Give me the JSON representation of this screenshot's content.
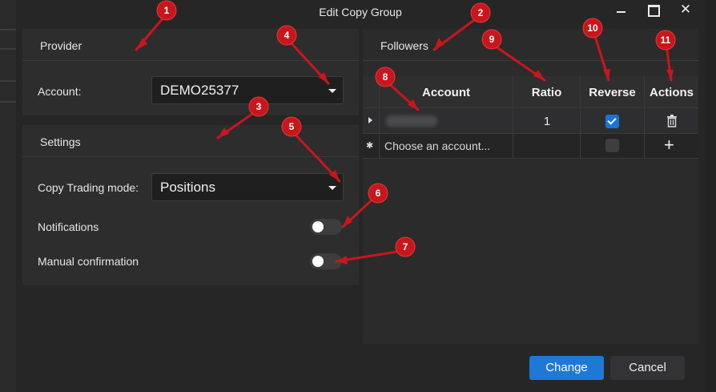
{
  "window": {
    "title": "Edit Copy Group",
    "close_glyph": "✕"
  },
  "provider": {
    "header": "Provider",
    "account_label": "Account:",
    "account_value": "DEMO25377"
  },
  "settings": {
    "header": "Settings",
    "mode_label": "Copy Trading mode:",
    "mode_value": "Positions",
    "notifications_label": "Notifications",
    "notifications_on": false,
    "manual_label": "Manual confirmation",
    "manual_on": false
  },
  "followers": {
    "header": "Followers",
    "columns": [
      "Account",
      "Ratio",
      "Reverse",
      "Actions"
    ],
    "rows": [
      {
        "ratio": "1",
        "reverse": true
      }
    ],
    "new_row_placeholder": "Choose an account...",
    "add_glyph": "+"
  },
  "buttons": {
    "change": "Change",
    "cancel": "Cancel"
  },
  "annotations": [
    "1",
    "2",
    "3",
    "4",
    "5",
    "6",
    "7",
    "8",
    "9",
    "10",
    "11"
  ],
  "colors": {
    "accent": "#1d78d6",
    "annotation": "#c8161d"
  }
}
